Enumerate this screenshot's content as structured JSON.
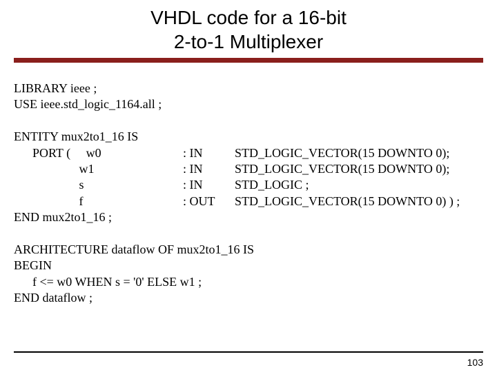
{
  "title": {
    "line1": "VHDL code for a 16-bit",
    "line2": "2-to-1 Multiplexer"
  },
  "library": {
    "l1": "LIBRARY ieee ;",
    "l2": "USE ieee.std_logic_1164.all ;"
  },
  "entity": {
    "l1": "ENTITY mux2to1_16 IS",
    "ports": [
      {
        "a": "      PORT (     w0",
        "b": ": IN",
        "c": "STD_LOGIC_VECTOR(15 DOWNTO 0);"
      },
      {
        "a": "                     w1",
        "b": ": IN",
        "c": "STD_LOGIC_VECTOR(15 DOWNTO 0);"
      },
      {
        "a": "                     s",
        "b": ": IN",
        "c": "STD_LOGIC ;"
      },
      {
        "a": "                     f",
        "b": ": OUT",
        "c": "STD_LOGIC_VECTOR(15 DOWNTO 0) ) ;"
      }
    ],
    "end": "END mux2to1_16 ;"
  },
  "architecture": {
    "l1": "ARCHITECTURE dataflow OF mux2to1_16 IS",
    "l2": "BEGIN",
    "l3": "      f <= w0 WHEN s = '0' ELSE w1 ;",
    "l4": "END dataflow ;"
  },
  "page_number": "103"
}
